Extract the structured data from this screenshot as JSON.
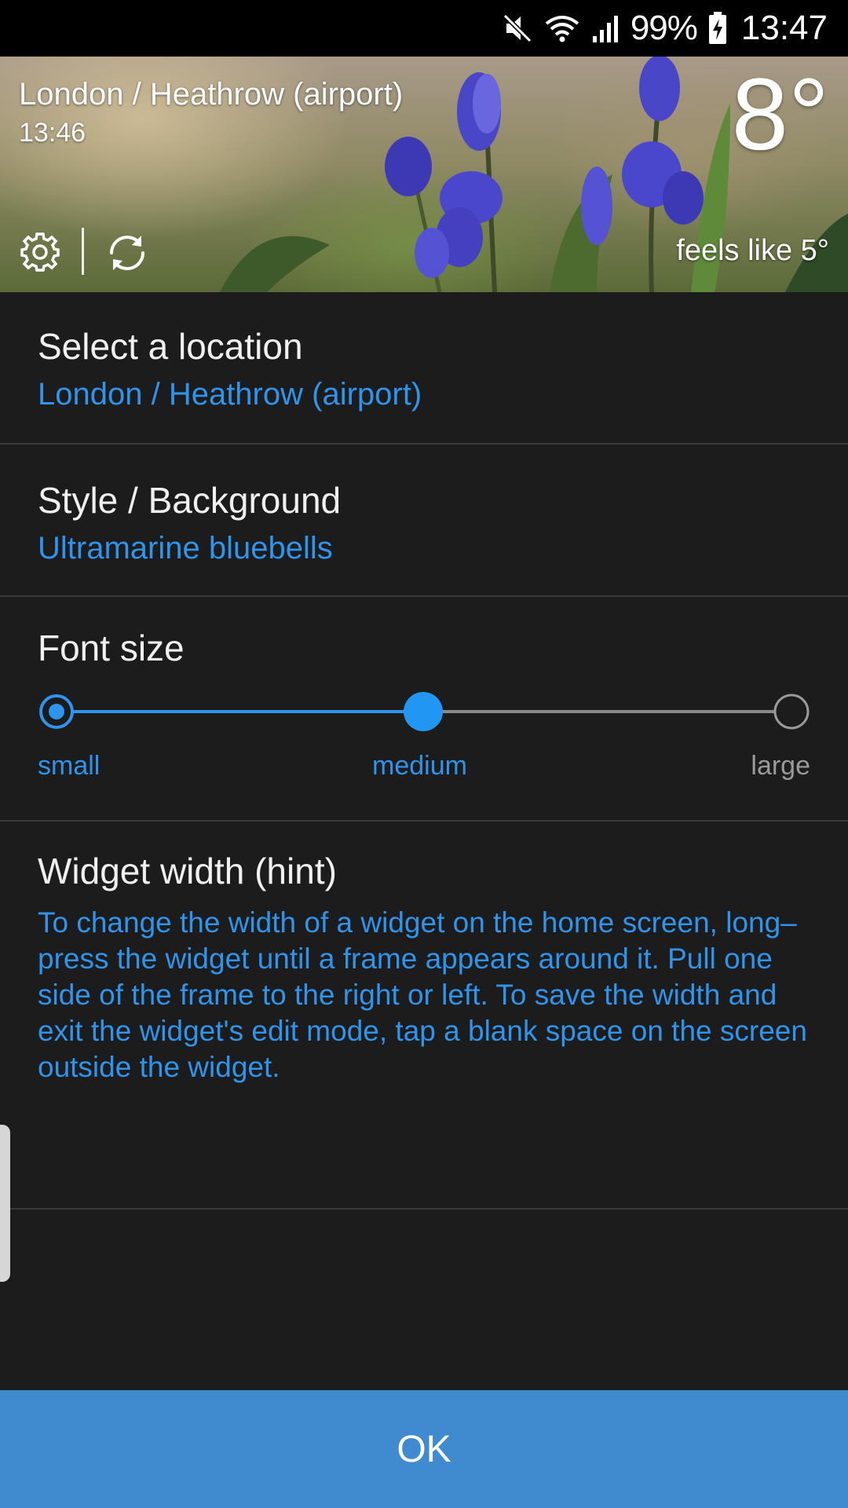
{
  "status_bar": {
    "icons": [
      "mute-icon",
      "wifi-icon",
      "signal-icon",
      "battery-charging-icon"
    ],
    "battery": "99%",
    "time": "13:47"
  },
  "widget_preview": {
    "location": "London / Heathrow (airport)",
    "time": "13:46",
    "temperature": "8°",
    "feels_like": "feels like 5°",
    "icons": [
      "gear-icon",
      "refresh-icon"
    ],
    "background": "bluebells photo"
  },
  "settings": {
    "location": {
      "title": "Select a location",
      "value": "London / Heathrow (airport)"
    },
    "style": {
      "title": "Style / Background",
      "value": "Ultramarine bluebells"
    },
    "font_size": {
      "title": "Font size",
      "options": [
        "small",
        "medium",
        "large"
      ],
      "selected": "medium",
      "selected_index": 1
    },
    "widget_width": {
      "title": "Widget width (hint)",
      "text": "To change the width of a widget on the home screen, long–press the widget until a frame appears around it. Pull one side of the frame to the right or left. To save the width and exit the widget's edit mode, tap a blank space on the screen outside the widget."
    }
  },
  "ok_button": {
    "label": "OK"
  },
  "colors": {
    "accent": "#2f94ec",
    "button": "#408bcf",
    "background": "#1c1c1c",
    "divider": "#3a3a3a"
  }
}
